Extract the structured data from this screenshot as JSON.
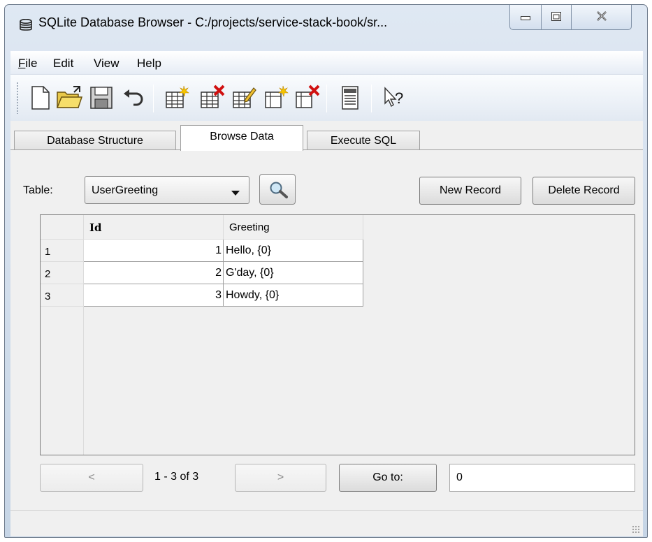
{
  "window": {
    "title": "SQLite Database Browser - C:/projects/service-stack-book/sr..."
  },
  "menu": {
    "items": [
      "File",
      "Edit",
      "View",
      "Help"
    ],
    "file_underline": "F",
    "file_rest": "ile"
  },
  "toolbar": {
    "icons": [
      "new-database-icon",
      "open-database-icon",
      "save-icon",
      "undo-icon",
      "create-table-icon",
      "delete-table-icon",
      "modify-table-icon",
      "create-index-icon",
      "delete-index-icon",
      "log-icon",
      "whats-this-icon"
    ]
  },
  "tabs": [
    {
      "label": "Database Structure",
      "active": false
    },
    {
      "label": "Browse Data",
      "active": true
    },
    {
      "label": "Execute SQL",
      "active": false
    }
  ],
  "browse": {
    "table_label": "Table:",
    "table_selected": "UserGreeting",
    "new_record_label": "New Record",
    "delete_record_label": "Delete Record",
    "columns": [
      "Id",
      "Greeting"
    ],
    "rows": [
      {
        "row": "1",
        "id": "1",
        "greeting": "Hello, {0}"
      },
      {
        "row": "2",
        "id": "2",
        "greeting": "G'day, {0}"
      },
      {
        "row": "3",
        "id": "3",
        "greeting": "Howdy, {0}"
      }
    ]
  },
  "pager": {
    "prev_label": "<",
    "range_text": "1 - 3 of 3",
    "next_label": ">",
    "goto_label": "Go to:",
    "goto_value": "0"
  }
}
